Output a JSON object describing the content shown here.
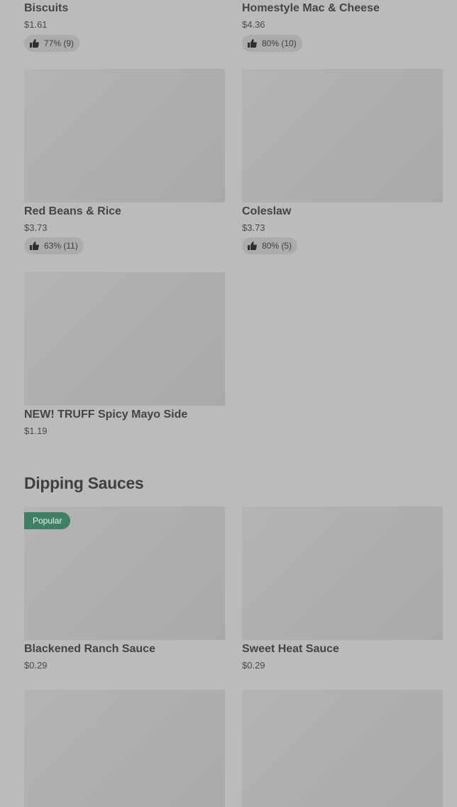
{
  "sides": {
    "items": [
      {
        "name": "Biscuits",
        "price": "$1.61",
        "rating": "77% (9)"
      },
      {
        "name": "Homestyle Mac & Cheese",
        "price": "$4.36",
        "rating": "80% (10)"
      },
      {
        "name": "Red Beans & Rice",
        "price": "$3.73",
        "rating": "63% (11)"
      },
      {
        "name": "Coleslaw",
        "price": "$3.73",
        "rating": "80% (5)"
      },
      {
        "name": "NEW! TRUFF Spicy Mayo Side",
        "price": "$1.19"
      }
    ]
  },
  "dipping_sauces": {
    "title": "Dipping Sauces",
    "badge": "Popular",
    "items": [
      {
        "name": "Blackened Ranch Sauce",
        "price": "$0.29"
      },
      {
        "name": "Sweet Heat Sauce",
        "price": "$0.29"
      }
    ]
  },
  "colors": {
    "background": "#bbbbbb",
    "image_placeholder": "#afafaf",
    "badge": "#3e8063"
  },
  "icons": {
    "rating": "thumbs-up-icon"
  }
}
